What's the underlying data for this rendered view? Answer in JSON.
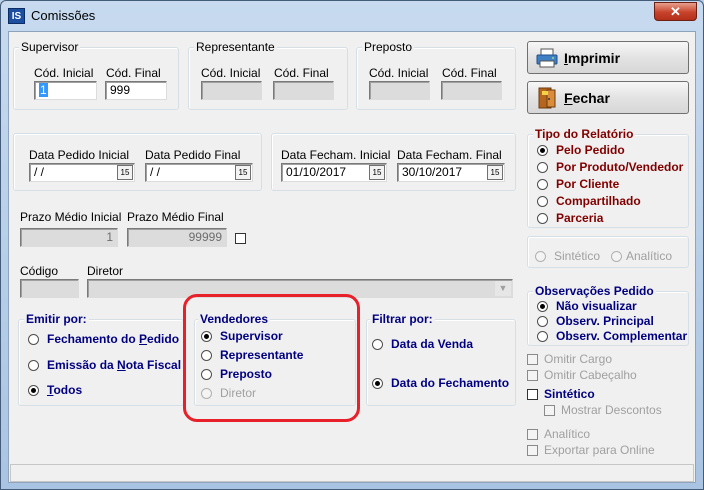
{
  "window": {
    "title": "Comissões",
    "icon_text": "IS",
    "close_glyph": "✕"
  },
  "supervisor": {
    "legend": "Supervisor",
    "cod_inicial_label": "Cód. Inicial",
    "cod_final_label": "Cód. Final",
    "cod_inicial": "1",
    "cod_final": "999"
  },
  "representante": {
    "legend": "Representante",
    "cod_inicial_label": "Cód. Inicial",
    "cod_final_label": "Cód. Final",
    "cod_inicial": "",
    "cod_final": ""
  },
  "preposto": {
    "legend": "Preposto",
    "cod_inicial_label": "Cód. Inicial",
    "cod_final_label": "Cód. Final",
    "cod_inicial": "",
    "cod_final": ""
  },
  "pedido_dates": {
    "inicial_label": "Data Pedido Inicial",
    "final_label": "Data Pedido Final",
    "inicial": " /  /",
    "final": " /  /"
  },
  "fecham_dates": {
    "inicial_label": "Data Fecham. Inicial",
    "final_label": "Data Fecham. Final",
    "inicial": "01/10/2017",
    "final": "30/10/2017"
  },
  "calendar_glyph": "15",
  "prazo": {
    "inicial_label": "Prazo Médio Inicial",
    "final_label": "Prazo Médio Final",
    "inicial": "1",
    "final": "99999"
  },
  "codigo_label": "Código",
  "diretor_label": "Diretor",
  "dropdown_glyph": "▼",
  "buttons": {
    "imprimir_pre": "I",
    "imprimir_rest": "mprimir",
    "fechar_pre": "F",
    "fechar_rest": "echar"
  },
  "tipo_relatorio": {
    "legend": "Tipo do Relatório",
    "options": [
      "Pelo Pedido",
      "Por Produto/Vendedor",
      "Por Cliente",
      "Compartilhado",
      "Parceria"
    ],
    "selected": "Pelo Pedido"
  },
  "sintetico_analitico": {
    "sintetico": "Sintético",
    "analitico": "Analítico"
  },
  "observacoes": {
    "legend": "Observações Pedido",
    "options": [
      "Não visualizar",
      "Observ. Principal",
      "Observ. Complementar"
    ],
    "selected": "Não visualizar"
  },
  "checks": {
    "omitir_cargo": "Omitir Cargo",
    "omitir_cabecalho": "Omitir Cabeçalho",
    "sintetico": "Sintético",
    "mostrar_descontos": "Mostrar Descontos",
    "analitico": "Analítico",
    "exportar_online": "Exportar para Online"
  },
  "emitir_por": {
    "legend": "Emitir por:",
    "fechamento_pre": "Fechamento do ",
    "fechamento_u": "P",
    "fechamento_post": "edido",
    "emissao_pre": "Emissão da ",
    "emissao_u": "N",
    "emissao_post": "ota Fiscal",
    "todos_u": "T",
    "todos_post": "odos",
    "selected": "Todos"
  },
  "vendedores": {
    "legend": "Vendedores",
    "options": [
      "Supervisor",
      "Representante",
      "Preposto",
      "Diretor"
    ],
    "selected": "Supervisor"
  },
  "filtrar_por": {
    "legend": "Filtrar por:",
    "options": [
      "Data da Venda",
      "Data do Fechamento"
    ],
    "selected": "Data do Fechamento"
  },
  "colors": {
    "accent_label": "#000080",
    "tipo_label": "#800000",
    "highlight": "#e8202a"
  }
}
